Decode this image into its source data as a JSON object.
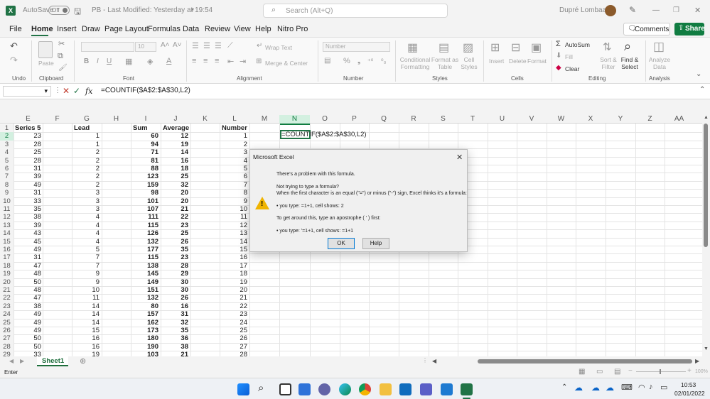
{
  "titlebar": {
    "autosave_label": "AutoSave",
    "autosave_state": "Off",
    "doc_title": "PB  -  Last Modified: Yesterday at 19:54",
    "search_placeholder": "Search (Alt+Q)",
    "user_name": "Dupré Lombaard"
  },
  "menu": {
    "items": [
      "File",
      "Home",
      "Insert",
      "Draw",
      "Page Layout",
      "Formulas",
      "Data",
      "Review",
      "View",
      "Help",
      "Nitro Pro"
    ],
    "comments": "Comments",
    "share": "Share"
  },
  "ribbon": {
    "undo_label": "Undo",
    "clipboard_label": "Clipboard",
    "paste": "Paste",
    "font_size": "10",
    "font_label": "Font",
    "wrap_text": "Wrap Text",
    "merge_center": "Merge & Center",
    "alignment_label": "Alignment",
    "number_format": "Number",
    "number_label": "Number",
    "conditional_formatting": "Conditional Formatting",
    "format_as_table": "Format as Table",
    "cell_styles": "Cell Styles",
    "styles_label": "Styles",
    "insert": "Insert",
    "delete": "Delete",
    "format": "Format",
    "cells_label": "Cells",
    "autosum": "AutoSum",
    "fill": "Fill",
    "clear": "Clear",
    "sort_filter": "Sort & Filter",
    "find_select": "Find & Select",
    "editing_label": "Editing",
    "analyze_data": "Analyze Data",
    "analysis_label": "Analysis"
  },
  "formula_bar": {
    "fx": "fx",
    "formula": "=COUNTIF($A$2:$A$30,L2)"
  },
  "columns": [
    "E",
    "F",
    "G",
    "H",
    "I",
    "J",
    "K",
    "L",
    "M",
    "N",
    "O",
    "P",
    "Q",
    "R",
    "S",
    "T",
    "U",
    "V",
    "W",
    "X",
    "Y",
    "Z",
    "AA"
  ],
  "headers": {
    "series": "Series 5",
    "lead": "Lead",
    "sum": "Sum",
    "average": "Average",
    "number": "Number"
  },
  "rows": [
    [
      23,
      1,
      60,
      12,
      1
    ],
    [
      28,
      1,
      94,
      19,
      2
    ],
    [
      25,
      2,
      71,
      14,
      3
    ],
    [
      28,
      2,
      81,
      16,
      4
    ],
    [
      31,
      2,
      88,
      18,
      5
    ],
    [
      39,
      2,
      123,
      25,
      6
    ],
    [
      49,
      2,
      159,
      32,
      7
    ],
    [
      31,
      3,
      98,
      20,
      8
    ],
    [
      33,
      3,
      101,
      20,
      9
    ],
    [
      35,
      3,
      107,
      21,
      10
    ],
    [
      38,
      4,
      111,
      22,
      11
    ],
    [
      39,
      4,
      115,
      23,
      12
    ],
    [
      43,
      4,
      126,
      25,
      13
    ],
    [
      45,
      4,
      132,
      26,
      14
    ],
    [
      49,
      5,
      177,
      35,
      15
    ],
    [
      31,
      7,
      115,
      23,
      16
    ],
    [
      47,
      7,
      138,
      28,
      17
    ],
    [
      48,
      9,
      145,
      29,
      18
    ],
    [
      50,
      9,
      149,
      30,
      19
    ],
    [
      48,
      10,
      151,
      30,
      20
    ],
    [
      47,
      11,
      132,
      26,
      21
    ],
    [
      38,
      14,
      80,
      16,
      22
    ],
    [
      49,
      14,
      157,
      31,
      23
    ],
    [
      49,
      14,
      162,
      32,
      24
    ],
    [
      49,
      15,
      173,
      35,
      25
    ],
    [
      50,
      16,
      180,
      36,
      26
    ],
    [
      50,
      16,
      190,
      38,
      27
    ],
    [
      33,
      19,
      103,
      21,
      28
    ]
  ],
  "edit_cell_text": "=COUNTIF($A$2:$A$30,L2)",
  "dialog": {
    "title": "Microsoft Excel",
    "line1": "There's a problem with this formula.",
    "line2": "Not trying to type a formula?",
    "line3": "When the first character is an equal (\"=\") or minus (\"-\") sign, Excel thinks it's a formula:",
    "line4": "• you type:   =1+1, cell shows:   2",
    "line5": "To get around this, type an apostrophe ( ' ) first:",
    "line6": "• you type:   '=1+1, cell shows:   =1+1",
    "ok": "OK",
    "help": "Help"
  },
  "sheet_tab": "Sheet1",
  "status": {
    "mode": "Enter",
    "zoom": "100%"
  },
  "clock": {
    "time": "10:53",
    "date": "02/01/2022"
  },
  "colors": {
    "excel_green": "#217346",
    "share_green": "#107c41",
    "sheet_tab_green": "#1e6e3c"
  }
}
